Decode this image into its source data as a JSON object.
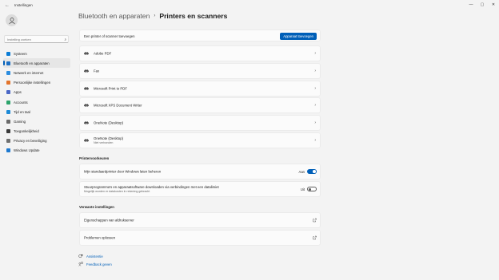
{
  "window": {
    "app_title": "Instellingen",
    "back_glyph": "←",
    "controls": {
      "minimize": "—",
      "maximize": "▢",
      "close": "✕"
    }
  },
  "sidebar": {
    "search_placeholder": "Instelling zoeken",
    "items": [
      {
        "label": "Systeem",
        "icon": "monitor-icon",
        "color": "#0a7cd6"
      },
      {
        "label": "Bluetooth en apparaten",
        "icon": "bluetooth-icon",
        "color": "#1b6fc4",
        "active": true
      },
      {
        "label": "Netwerk en internet",
        "icon": "wifi-icon",
        "color": "#2b8de0"
      },
      {
        "label": "Persoonlijke instellingen",
        "icon": "pen-icon",
        "color": "#e3742b"
      },
      {
        "label": "Apps",
        "icon": "apps-icon",
        "color": "#4a67c6"
      },
      {
        "label": "Accounts",
        "icon": "person-icon",
        "color": "#2ba36b"
      },
      {
        "label": "Tijd en taal",
        "icon": "clock-icon",
        "color": "#1d8ad7"
      },
      {
        "label": "Gaming",
        "icon": "gamepad-icon",
        "color": "#6a6a6a"
      },
      {
        "label": "Toegankelijkheid",
        "icon": "accessibility-icon",
        "color": "#3a3a3a"
      },
      {
        "label": "Privacy en beveiliging",
        "icon": "shield-icon",
        "color": "#707070"
      },
      {
        "label": "Windows Update",
        "icon": "update-icon",
        "color": "#1d79d0"
      }
    ]
  },
  "breadcrumb": {
    "parent": "Bluetooth en apparaten",
    "separator": "›",
    "current": "Printers en scanners"
  },
  "add_device": {
    "label": "Een printer of scanner toevoegen",
    "button": "Apparaat toevoegen"
  },
  "printers": [
    {
      "name": "Adobe PDF",
      "status": ""
    },
    {
      "name": "Fax",
      "status": ""
    },
    {
      "name": "Microsoft Print to PDF",
      "status": ""
    },
    {
      "name": "Microsoft XPS Document Writer",
      "status": ""
    },
    {
      "name": "OneNote (Desktop)",
      "status": ""
    },
    {
      "name": "OneNote (Desktop)",
      "status": "Niet verbonden"
    }
  ],
  "printer_prefs": {
    "heading": "Printervoorkeuren",
    "default_printer": {
      "label": "Mijn standaardprinter door Windows laten beheren",
      "state": "Aan"
    },
    "metered": {
      "label": "Stuurprogramma's en apparaatsoftware downloaden via verbindingen met een datalimiet",
      "sub": "Mogelijk worden er datakosten in rekening gebracht",
      "state": "Uit"
    }
  },
  "related": {
    "heading": "Verwante instellingen",
    "items": [
      {
        "label": "Eigenschappen van afdrukserver"
      },
      {
        "label": "Problemen oplossen"
      }
    ]
  },
  "help_links": [
    {
      "label": "Assistentie",
      "icon": "help-icon"
    },
    {
      "label": "Feedback geven",
      "icon": "feedback-icon"
    }
  ],
  "colors": {
    "accent": "#005fb8",
    "background": "#f3f3f3",
    "card": "#fbfbfb"
  }
}
